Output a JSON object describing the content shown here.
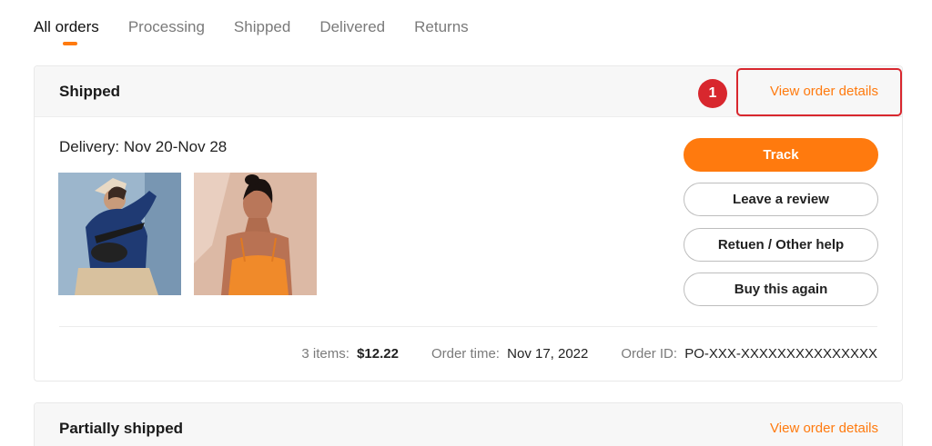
{
  "tabs": [
    {
      "label": "All orders",
      "active": true
    },
    {
      "label": "Processing",
      "active": false
    },
    {
      "label": "Shipped",
      "active": false
    },
    {
      "label": "Delivered",
      "active": false
    },
    {
      "label": "Returns",
      "active": false
    }
  ],
  "orders": [
    {
      "status": "Shipped",
      "view_link": "View order details",
      "step_badge": "1",
      "delivery": "Delivery: Nov 20-Nov 28",
      "buttons": {
        "track": "Track",
        "review": "Leave a review",
        "return": "Retuen / Other help",
        "buy_again": "Buy this again"
      },
      "summary": {
        "items_label": "3 items:",
        "items_value": "$12.22",
        "time_label": "Order time:",
        "time_value": "Nov 17, 2022",
        "id_label": "Order ID:",
        "id_value": "PO-XXX-XXXXXXXXXXXXXXX"
      }
    },
    {
      "status": "Partially shipped",
      "view_link": "View order details"
    }
  ],
  "colors": {
    "accent": "#ff7a0e",
    "highlight": "#d8272e"
  }
}
